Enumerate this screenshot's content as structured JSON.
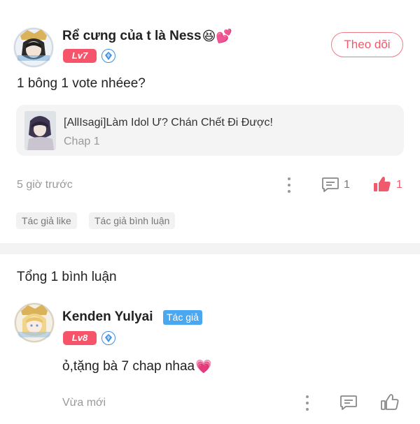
{
  "post": {
    "username": "Rể cưng của t là Ness",
    "username_emoji": "😆💕",
    "level": "Lv7",
    "follow_label": "Theo dõi",
    "content": "1 bông 1 vote nhéee?",
    "reference": {
      "title": "[AllIsagi]Làm Idol Ư? Chán Chết Đi Được!",
      "chapter": "Chap 1"
    },
    "time": "5 giờ trước",
    "comment_count": "1",
    "like_count": "1",
    "tags": [
      "Tác giả like",
      "Tác giả bình luận"
    ]
  },
  "comments_section": {
    "total_label": "Tổng 1 bình luận"
  },
  "comment": {
    "username": "Kenden Yulyai",
    "author_badge": "Tác giả",
    "level": "Lv8",
    "content": "ỏ,tặng bà 7 chap nhaa",
    "content_emoji": "💗",
    "time": "Vừa mới"
  },
  "colors": {
    "accent_pink": "#ef5a6c",
    "level_badge": "#f5546a",
    "author_badge_blue": "#4aa8f0",
    "gem_blue": "#3d8fe0"
  },
  "icons": [
    "more-vertical-icon",
    "comment-icon",
    "thumbs-up-filled-icon",
    "thumbs-up-outline-icon",
    "diamond-gem-icon"
  ]
}
